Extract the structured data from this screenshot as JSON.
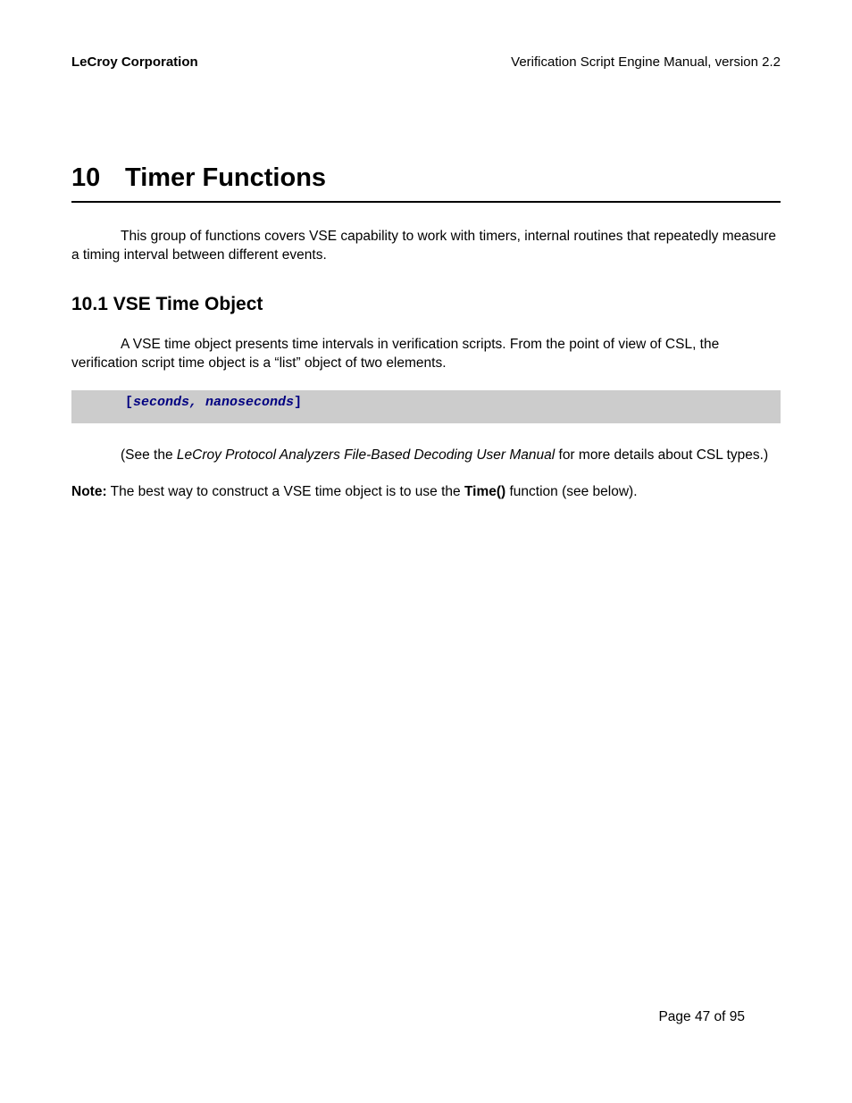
{
  "header": {
    "left": "LeCroy Corporation",
    "right": "Verification Script Engine Manual, version 2.2"
  },
  "chapter": {
    "number": "10",
    "title": "Timer Functions"
  },
  "intro_para": "This group of functions covers VSE capability to work with timers, internal routines that repeatedly measure a timing interval between different events.",
  "section": {
    "number_title": "10.1  VSE Time Object"
  },
  "section_para": "A VSE time object presents time intervals in verification scripts. From the point of view of CSL, the verification script time object is a “list” object of two elements.",
  "code": {
    "open": "[",
    "body": "seconds, nanoseconds",
    "close": "]"
  },
  "see_para": {
    "pre": "(See the ",
    "ital": "LeCroy Protocol Analyzers File-Based Decoding User Manual",
    "post": " for more details about CSL types.)"
  },
  "note": {
    "label": "Note:",
    "pre": " The best way to construct a VSE time object is to use the ",
    "bold": "Time()",
    "post": " function (see below)."
  },
  "footer": "Page 47 of 95"
}
